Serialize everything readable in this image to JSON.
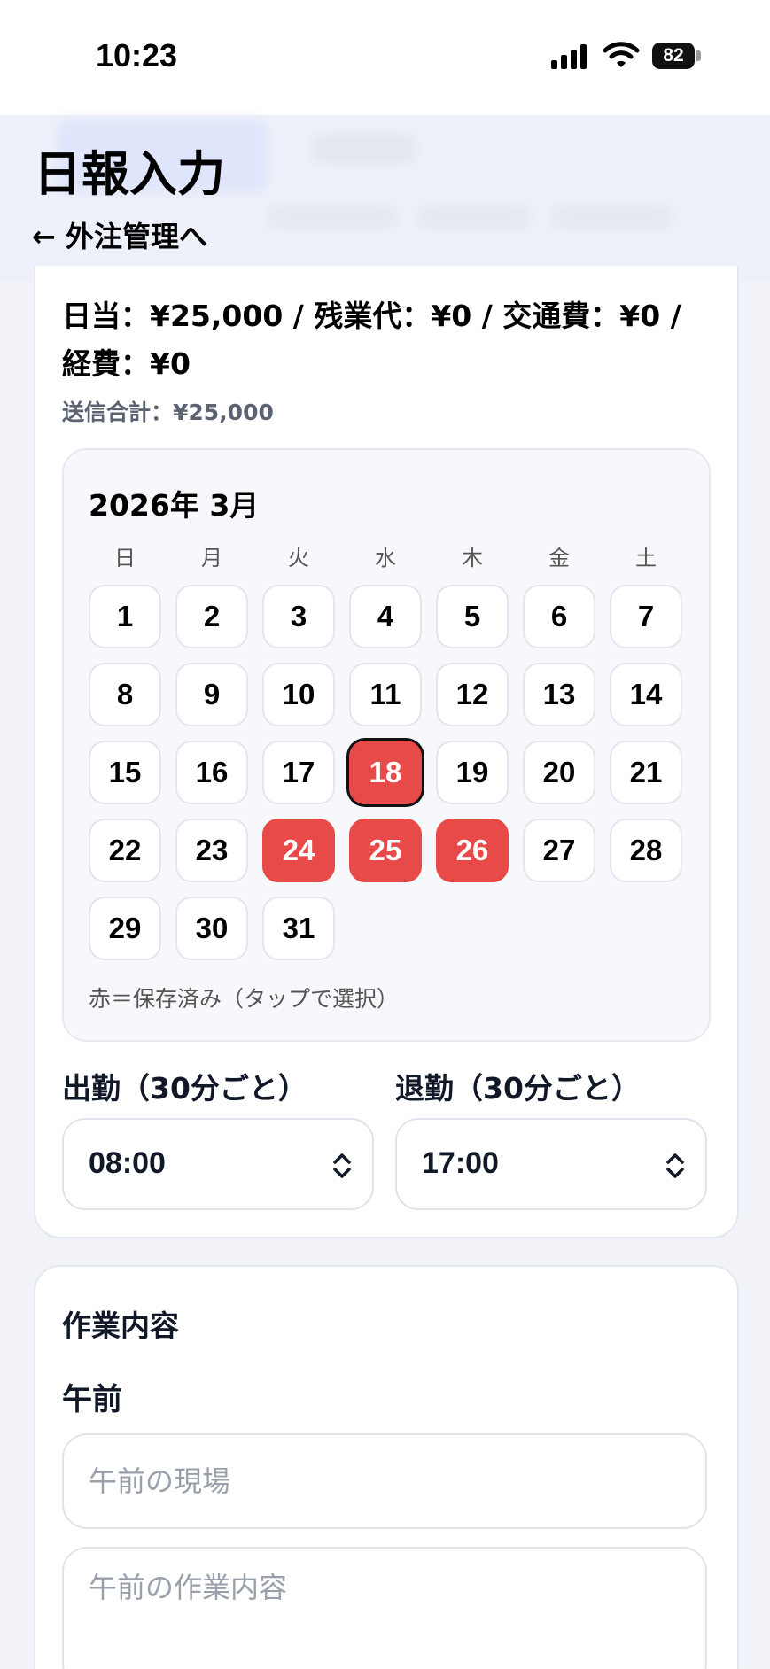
{
  "status": {
    "time": "10:23",
    "battery": "82"
  },
  "header": {
    "title": "日報入力",
    "back_link": "← 外注管理へ"
  },
  "summary": {
    "line": "日当：¥25,000 / 残業代：¥0 / 交通費：¥0 / 経費：¥0",
    "total": "送信合計：¥25,000"
  },
  "calendar": {
    "title": "2026年 3月",
    "weekdays": [
      "日",
      "月",
      "火",
      "水",
      "木",
      "金",
      "土"
    ],
    "first_weekday_index": 0,
    "days_in_month": 31,
    "saved_days": [
      18,
      24,
      25,
      26
    ],
    "selected_day": 18,
    "legend": "赤＝保存済み（タップで選択）",
    "saved_color": "#e84a4a"
  },
  "times": {
    "start_label": "出勤（30分ごと）",
    "start_value": "08:00",
    "end_label": "退勤（30分ごと）",
    "end_value": "17:00"
  },
  "work": {
    "section_title": "作業内容",
    "am_title": "午前",
    "am_site_placeholder": "午前の現場",
    "am_work_placeholder": "午前の作業内容"
  }
}
